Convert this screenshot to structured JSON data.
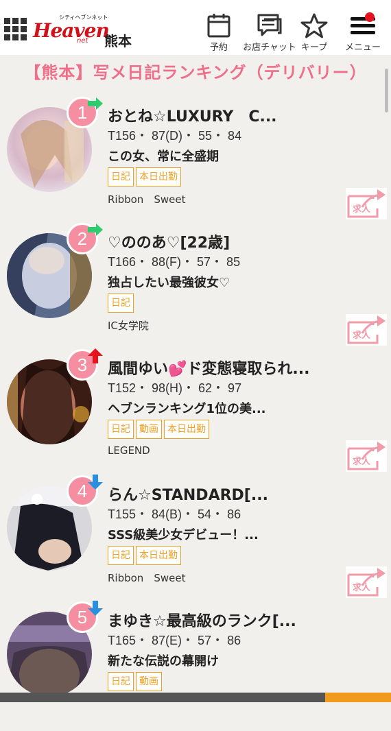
{
  "header": {
    "brand_tag": "シティヘブンネット",
    "brand_main": "Heaven",
    "brand_city": "City",
    "brand_sub": "net",
    "area": "熊本",
    "buttons": [
      {
        "label": "予約"
      },
      {
        "label": "お店チャット"
      },
      {
        "label": "キープ"
      },
      {
        "label": "メニュー"
      }
    ]
  },
  "page_title": "【熊本】写メ日記ランキング（デリバリー）",
  "entries": [
    {
      "rank": "1",
      "trend": "same",
      "name": "おとね☆LUXURY　C...",
      "stats": "T156・ 87(D)・ 55・ 84",
      "catch": "この女、常に全盛期",
      "tags": [
        "日記",
        "本日出勤"
      ],
      "shop": "Ribbon　Sweet",
      "recruit": "求人"
    },
    {
      "rank": "2",
      "trend": "same",
      "name": "♡ののあ♡[22歳]",
      "stats": "T166・ 88(F)・ 57・ 85",
      "catch": "独占したい最強彼女♡",
      "tags": [
        "日記"
      ],
      "shop": "IC女学院",
      "recruit": "求人"
    },
    {
      "rank": "3",
      "trend": "up",
      "name": "風間ゆい💕ド変態寝取られ...",
      "stats": "T152・ 98(H)・ 62・ 97",
      "catch": "ヘブンランキング1位の美...",
      "tags": [
        "日記",
        "動画",
        "本日出勤"
      ],
      "shop": "LEGEND",
      "recruit": "求人"
    },
    {
      "rank": "4",
      "trend": "down",
      "name": "らん☆STANDARD[...",
      "stats": "T155・ 84(B)・ 54・ 86",
      "catch": "SSS級美少女デビュー！...",
      "tags": [
        "日記",
        "本日出勤"
      ],
      "shop": "Ribbon　Sweet",
      "recruit": "求人"
    },
    {
      "rank": "5",
      "trend": "down",
      "name": "まゆき☆最高級のランク[...",
      "stats": "T165・ 87(E)・ 57・ 86",
      "catch": "新たな伝説の幕開け",
      "tags": [
        "日記",
        "動画"
      ],
      "shop": "",
      "recruit": ""
    }
  ],
  "colors": {
    "rank_badge": "#f58ea0",
    "tag": "#f0a020",
    "title": "#ee6f8a",
    "brand": "#d0121b",
    "trend_same": "#2ecc71",
    "trend_up": "#e8141c",
    "trend_down": "#2b8fe0"
  }
}
